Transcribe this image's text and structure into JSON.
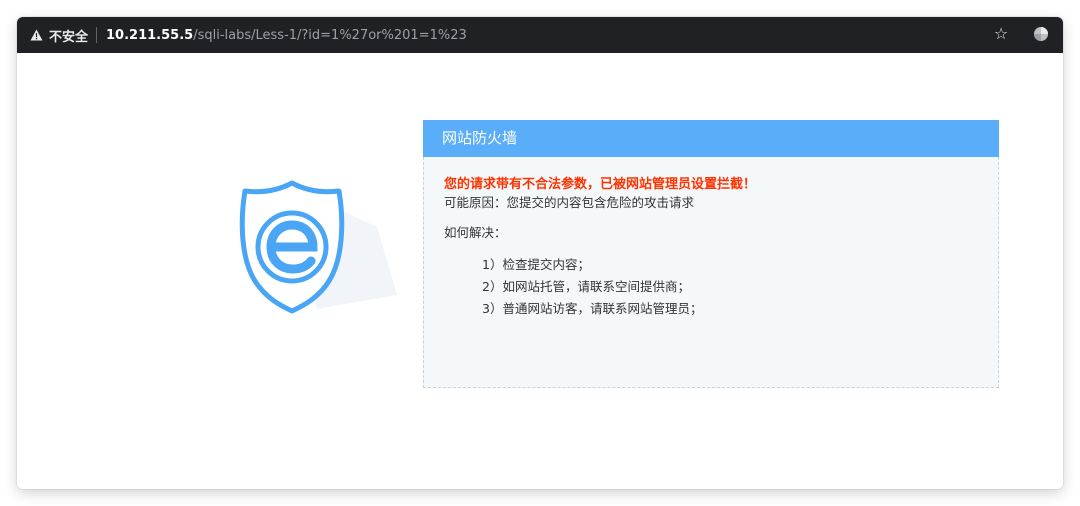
{
  "browser": {
    "insecure_label": "不安全",
    "url_host": "10.211.55.5",
    "url_path": "/sqli-labs/Less-1/?id=1%27or%201=1%23",
    "icons": [
      "warning-icon",
      "bookmark-star-icon",
      "profile-icon"
    ]
  },
  "waf": {
    "title": "网站防火墙",
    "alert": "您的请求带有不合法参数，已被网站管理员设置拦截！",
    "reason": "可能原因：您提交的内容包含危险的攻击请求",
    "howto": "如何解决：",
    "steps": [
      "1）检查提交内容；",
      "2）如网站托管，请联系空间提供商；",
      "3）普通网站访客，请联系网站管理员；"
    ],
    "colors": {
      "header": "#5aaef9",
      "alert": "#ff3300",
      "shield": "#4aa6f5"
    }
  }
}
